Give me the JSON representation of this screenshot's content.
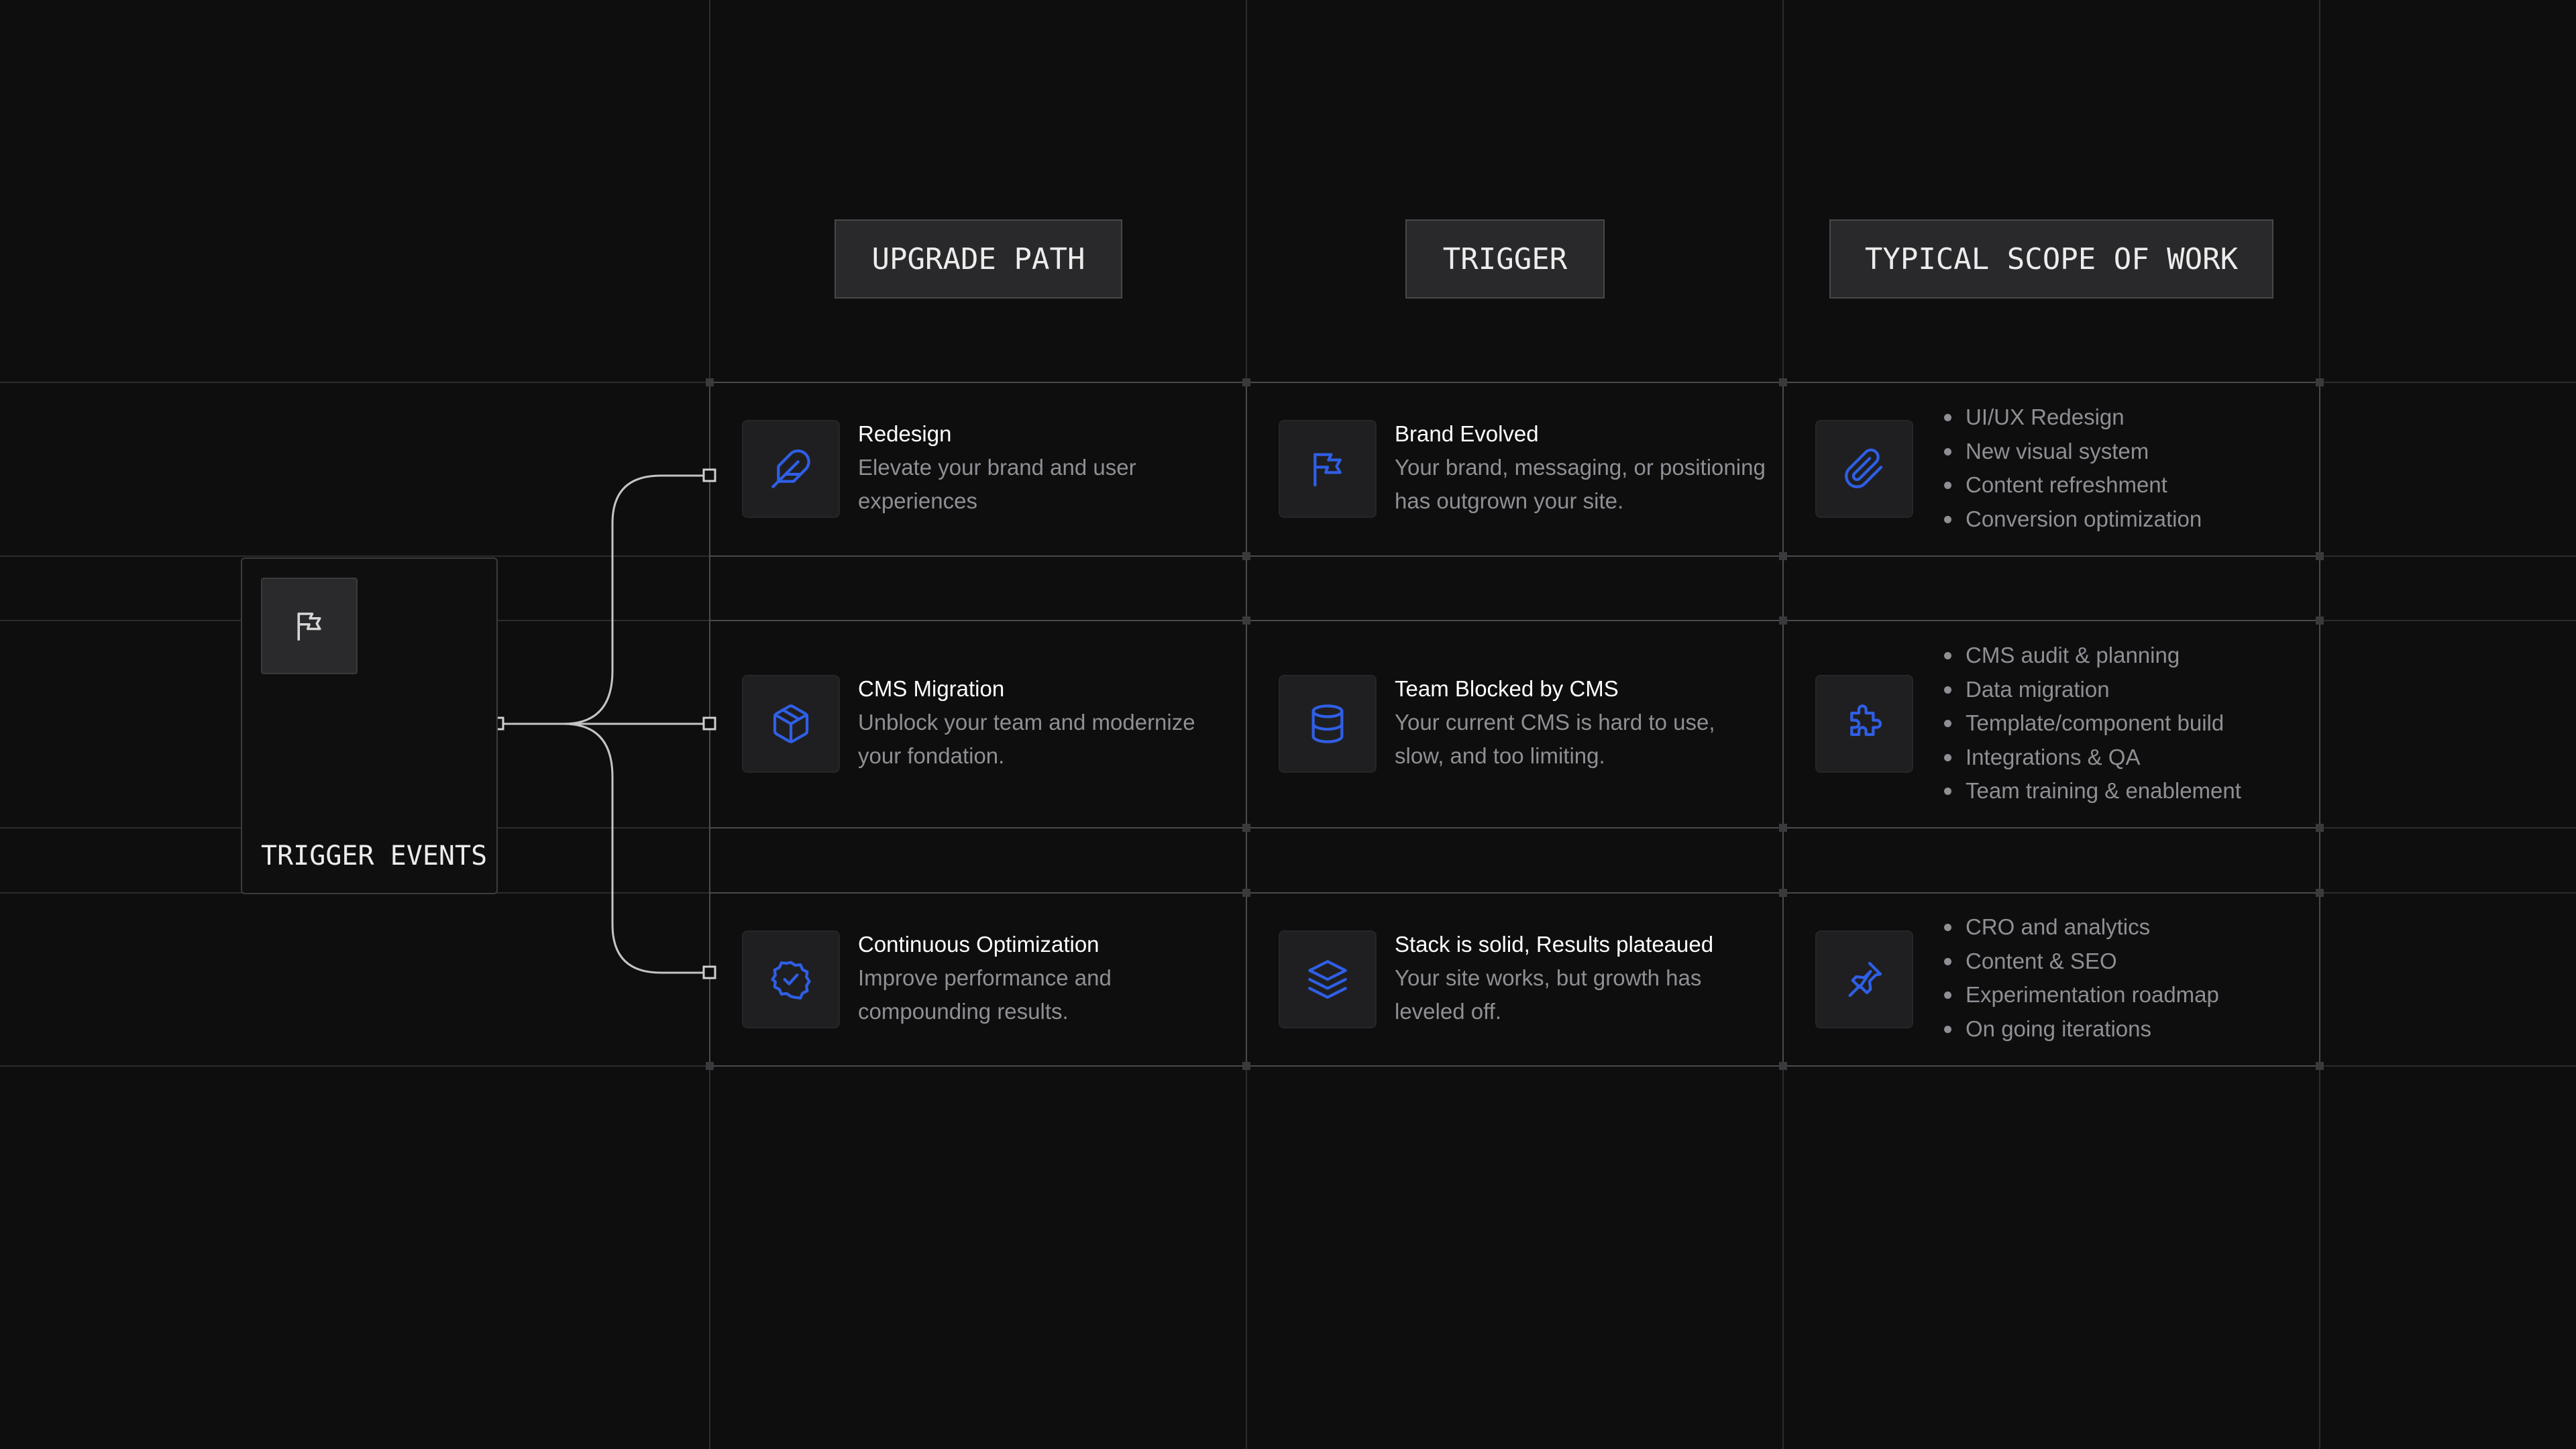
{
  "headers": {
    "upgrade_path": "UPGRADE PATH",
    "trigger": "TRIGGER",
    "scope": "TYPICAL SCOPE OF WORK"
  },
  "trigger_card": {
    "label": "TRIGGER EVENTS",
    "icon": "flag-icon"
  },
  "colors": {
    "background": "#0e0e0f",
    "accent_blue": "#2f5fe6",
    "grid_line": "#2c2c2e",
    "connector": "#c4c4c4",
    "muted_text": "#8f8f94"
  },
  "rows": [
    {
      "upgrade": {
        "icon": "feather-icon",
        "title": "Redesign",
        "description": "Elevate your brand and user experiences"
      },
      "trigger": {
        "icon": "flag-icon",
        "title": "Brand Evolved",
        "description": "Your brand, messaging, or positioning has outgrown your site."
      },
      "scope": {
        "icon": "paperclip-icon",
        "items": [
          "UI/UX Redesign",
          "New visual system",
          "Content refreshment",
          "Conversion optimization"
        ]
      }
    },
    {
      "upgrade": {
        "icon": "box-icon",
        "title": "CMS Migration",
        "description": "Unblock your team and modernize your fondation."
      },
      "trigger": {
        "icon": "database-icon",
        "title": "Team Blocked by CMS",
        "description": "Your current CMS is hard to use, slow, and too limiting."
      },
      "scope": {
        "icon": "puzzle-icon",
        "items": [
          "CMS audit & planning",
          "Data migration",
          "Template/component build",
          "Integrations & QA",
          "Team training & enablement"
        ]
      }
    },
    {
      "upgrade": {
        "icon": "badge-check-icon",
        "title": "Continuous Optimization",
        "description": "Improve performance and compounding results."
      },
      "trigger": {
        "icon": "layers-icon",
        "title": "Stack is solid, Results plateaued",
        "description": "Your site works, but growth has leveled off."
      },
      "scope": {
        "icon": "pin-icon",
        "items": [
          "CRO and analytics",
          "Content & SEO",
          "Experimentation roadmap",
          "On going iterations"
        ]
      }
    }
  ]
}
